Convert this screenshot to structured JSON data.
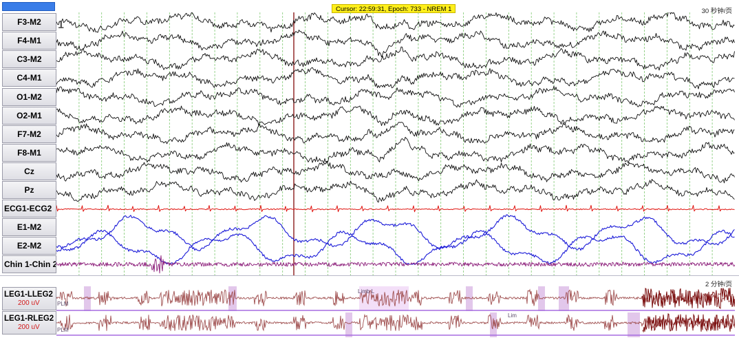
{
  "header": {
    "cursor_info": "Cursor: 22:59:31, Epoch: 733 - NREM 1",
    "top_scale": "30 秒钟/页",
    "bottom_scale": "2 分钟/页"
  },
  "channels": [
    "F3-M2",
    "F4-M1",
    "C3-M2",
    "C4-M1",
    "O1-M2",
    "O2-M1",
    "F7-M2",
    "F8-M1",
    "Cz",
    "Pz",
    "ECG1-ECG2",
    "E1-M2",
    "E2-M2",
    "Chin 1-Chin 2"
  ],
  "legs": [
    {
      "name": "LEG1-LLEG2",
      "gain": "200 uV"
    },
    {
      "name": "LEG1-RLEG2",
      "gain": "200 uV"
    }
  ],
  "markers": {
    "limb_l": "Limb L",
    "limb_short": "Lim",
    "plm": "PLM",
    "epoch_number": "1"
  },
  "colors": {
    "eeg": "#111111",
    "ecg": "#e0140f",
    "eog": "#1a1ad8",
    "emg": "#8a1a78",
    "leg": "#a05050",
    "leg_dark": "#7a0e0e",
    "grid": "#7ec870",
    "cursor_line": "#8a1a1a",
    "plm_line": "#a56be0",
    "highlight": "#d8b4e4",
    "highlight_bright": "#efd4f6"
  }
}
